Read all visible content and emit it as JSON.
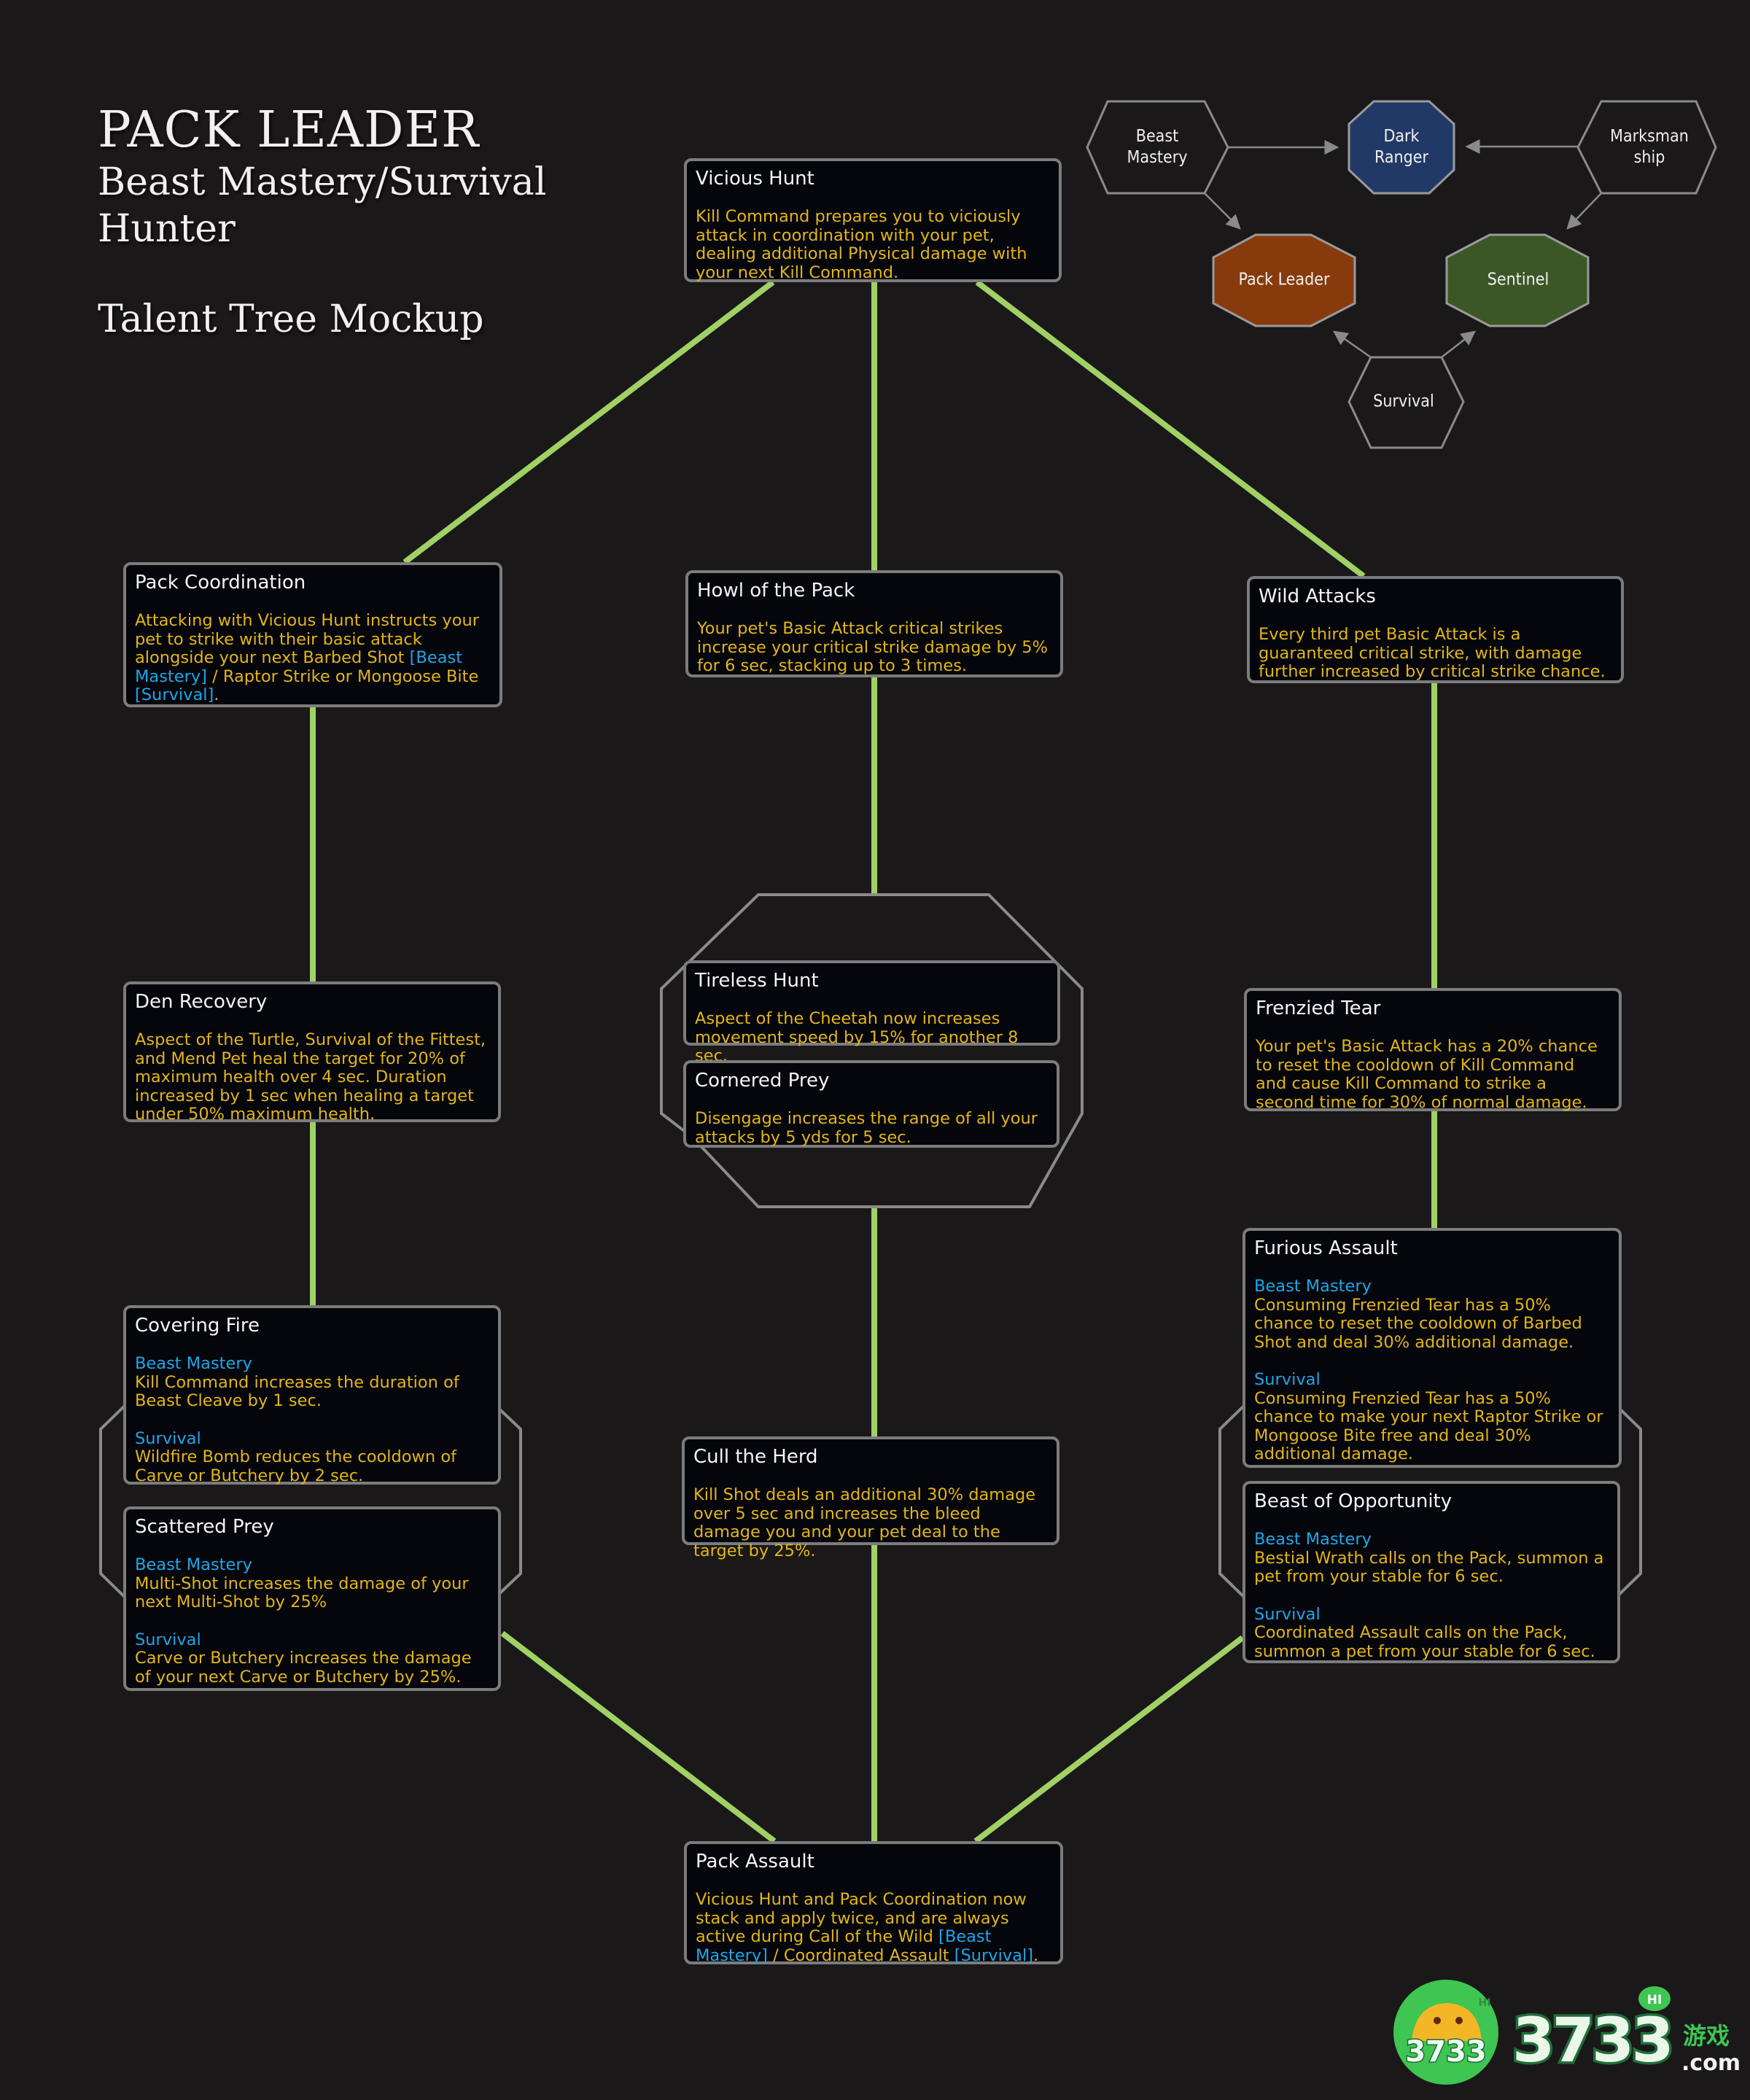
{
  "title": {
    "main": "PACK LEADER",
    "sub_line1": "Beast Mastery/Survival",
    "sub_line2": "Hunter",
    "mockup": "Talent Tree Mockup"
  },
  "colors": {
    "background": "#1a1819",
    "connector": "#9fd164",
    "card_bg": "#05050c",
    "card_border": "#7c7c7c",
    "talent_name": "#f5f5f5",
    "description": "#e2b616",
    "spec_label": "#1aa9e8",
    "dark_ranger": "#213966",
    "pack_leader": "#873b0d",
    "sentinel": "#3c5726",
    "hex_outline": "#8a8a8a"
  },
  "spec_map": {
    "nodes": [
      {
        "id": "beast-mastery",
        "label_lines": [
          "Beast",
          "Mastery"
        ],
        "kind": "spec"
      },
      {
        "id": "dark-ranger",
        "label_lines": [
          "Dark",
          "Ranger"
        ],
        "kind": "hero",
        "color": "#213966"
      },
      {
        "id": "marksmanship",
        "label_lines": [
          "Marksman",
          "ship"
        ],
        "kind": "spec"
      },
      {
        "id": "pack-leader",
        "label_lines": [
          "Pack Leader"
        ],
        "kind": "hero",
        "color": "#873b0d"
      },
      {
        "id": "sentinel",
        "label_lines": [
          "Sentinel"
        ],
        "kind": "hero",
        "color": "#3c5726"
      },
      {
        "id": "survival",
        "label_lines": [
          "Survival"
        ],
        "kind": "spec"
      }
    ],
    "arrows": [
      {
        "from": "beast-mastery",
        "to": "dark-ranger"
      },
      {
        "from": "marksmanship",
        "to": "dark-ranger"
      },
      {
        "from": "beast-mastery",
        "to": "pack-leader"
      },
      {
        "from": "marksmanship",
        "to": "sentinel"
      },
      {
        "from": "survival",
        "to": "pack-leader"
      },
      {
        "from": "survival",
        "to": "sentinel"
      }
    ]
  },
  "talents": {
    "vicious_hunt": {
      "name": "Vicious Hunt",
      "desc": "Kill Command prepares you to viciously attack in coordination with your pet, dealing additional Physical damage with your next Kill Command."
    },
    "pack_coordination": {
      "name": "Pack Coordination",
      "desc_parts": [
        {
          "text": "Attacking with Vicious Hunt instructs your pet to strike with their basic attack alongside your next Barbed Shot ",
          "spec": false
        },
        {
          "text": "[Beast Mastery]",
          "spec": true
        },
        {
          "text": " / Raptor Strike or Mongoose Bite ",
          "spec": false
        },
        {
          "text": "[Survival]",
          "spec": true
        },
        {
          "text": ".",
          "spec": false
        }
      ]
    },
    "howl_of_the_pack": {
      "name": "Howl of the Pack",
      "desc": "Your pet's Basic Attack critical strikes increase your critical strike damage by 5% for 6 sec, stacking up to 3 times."
    },
    "wild_attacks": {
      "name": "Wild Attacks",
      "desc": "Every third pet Basic Attack is a guaranteed critical strike, with damage further increased by critical strike chance."
    },
    "den_recovery": {
      "name": "Den Recovery",
      "desc": "Aspect of the Turtle, Survival of the Fittest, and Mend Pet heal the target for 20% of maximum health over 4 sec. Duration increased by 1 sec when healing a target under 50% maximum health."
    },
    "tireless_hunt": {
      "name": "Tireless Hunt",
      "desc": "Aspect of the Cheetah now increases movement speed by 15% for another 8 sec."
    },
    "cornered_prey": {
      "name": "Cornered Prey",
      "desc": "Disengage increases the range of all your attacks by 5 yds for 5 sec."
    },
    "frenzied_tear": {
      "name": "Frenzied Tear",
      "desc": "Your pet's Basic Attack has a 20% chance to reset the cooldown of Kill Command and cause Kill Command to strike a second time for 30% of normal damage."
    },
    "covering_fire": {
      "name": "Covering Fire",
      "bm_label": "Beast Mastery",
      "bm_desc": "Kill Command increases the duration of Beast Cleave by 1 sec.",
      "sv_label": "Survival",
      "sv_desc": "Wildfire Bomb reduces the cooldown of Carve or Butchery by 2 sec."
    },
    "scattered_prey": {
      "name": "Scattered Prey",
      "bm_label": "Beast Mastery",
      "bm_desc": "Multi-Shot increases the damage of your next Multi-Shot by 25%",
      "sv_label": "Survival",
      "sv_desc": "Carve or Butchery increases the damage of your next Carve or Butchery by 25%."
    },
    "cull_the_herd": {
      "name": "Cull the Herd",
      "desc": "Kill Shot deals an additional 30% damage over 5 sec and increases the bleed damage you and your pet deal to the target by 25%."
    },
    "furious_assault": {
      "name": "Furious Assault",
      "bm_label": "Beast Mastery",
      "bm_desc": "Consuming Frenzied Tear has a 50% chance to reset the cooldown of Barbed Shot and deal 30% additional damage.",
      "sv_label": "Survival",
      "sv_desc": "Consuming Frenzied Tear has a 50% chance to make your next Raptor Strike or Mongoose Bite free and deal 30% additional damage."
    },
    "beast_of_opportunity": {
      "name": "Beast of Opportunity",
      "bm_label": "Beast Mastery",
      "bm_desc": "Bestial Wrath calls on the Pack, summon a pet from your stable for 6 sec.",
      "sv_label": "Survival",
      "sv_desc": "Coordinated Assault calls on the Pack, summon a pet from your stable for 6 sec."
    },
    "pack_assault": {
      "name": "Pack Assault",
      "desc_parts": [
        {
          "text": "Vicious Hunt and Pack Coordination now stack and apply twice, and are always active during Call of the Wild ",
          "spec": false
        },
        {
          "text": "[Beast Mastery]",
          "spec": true
        },
        {
          "text": " / Coordinated Assault ",
          "spec": false
        },
        {
          "text": "[Survival]",
          "spec": true
        },
        {
          "text": ".",
          "spec": false
        }
      ]
    }
  },
  "connections": [
    [
      "vicious_hunt",
      "pack_coordination"
    ],
    [
      "vicious_hunt",
      "howl_of_the_pack"
    ],
    [
      "vicious_hunt",
      "wild_attacks"
    ],
    [
      "pack_coordination",
      "den_recovery"
    ],
    [
      "den_recovery",
      "covering_fire"
    ],
    [
      "howl_of_the_pack",
      "tireless_hunt"
    ],
    [
      "cornered_prey",
      "cull_the_herd"
    ],
    [
      "wild_attacks",
      "frenzied_tear"
    ],
    [
      "frenzied_tear",
      "furious_assault"
    ],
    [
      "scattered_prey",
      "pack_assault"
    ],
    [
      "cull_the_herd",
      "pack_assault"
    ],
    [
      "beast_of_opportunity",
      "pack_assault"
    ]
  ],
  "choice_groups": [
    [
      "tireless_hunt",
      "cornered_prey"
    ],
    [
      "covering_fire",
      "scattered_prey"
    ],
    [
      "furious_assault",
      "beast_of_opportunity"
    ]
  ],
  "watermark": {
    "badge_text": "3733",
    "badge_hi": "HI",
    "brand_number": "3733",
    "brand_cn": "游戏",
    "brand_domain": ".com",
    "brand_hi": "HI"
  }
}
